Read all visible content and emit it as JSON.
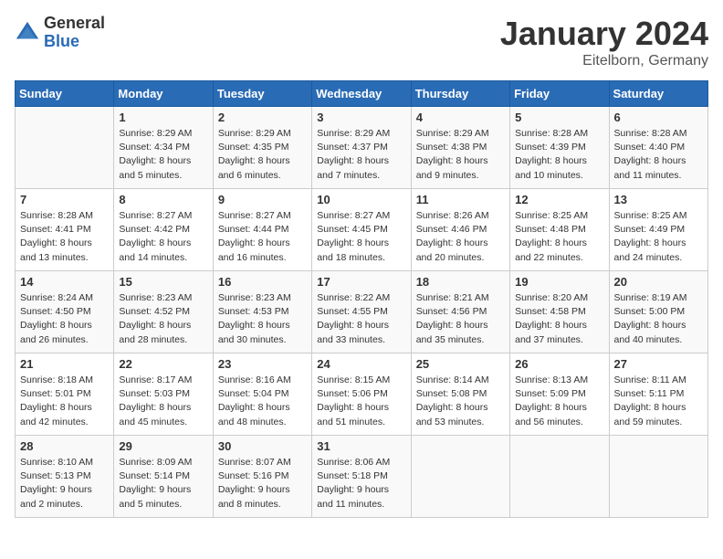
{
  "logo": {
    "text_general": "General",
    "text_blue": "Blue"
  },
  "title": "January 2024",
  "location": "Eitelborn, Germany",
  "weekdays": [
    "Sunday",
    "Monday",
    "Tuesday",
    "Wednesday",
    "Thursday",
    "Friday",
    "Saturday"
  ],
  "weeks": [
    [
      {
        "day": "",
        "sunrise": "",
        "sunset": "",
        "daylight": ""
      },
      {
        "day": "1",
        "sunrise": "Sunrise: 8:29 AM",
        "sunset": "Sunset: 4:34 PM",
        "daylight": "Daylight: 8 hours and 5 minutes."
      },
      {
        "day": "2",
        "sunrise": "Sunrise: 8:29 AM",
        "sunset": "Sunset: 4:35 PM",
        "daylight": "Daylight: 8 hours and 6 minutes."
      },
      {
        "day": "3",
        "sunrise": "Sunrise: 8:29 AM",
        "sunset": "Sunset: 4:37 PM",
        "daylight": "Daylight: 8 hours and 7 minutes."
      },
      {
        "day": "4",
        "sunrise": "Sunrise: 8:29 AM",
        "sunset": "Sunset: 4:38 PM",
        "daylight": "Daylight: 8 hours and 9 minutes."
      },
      {
        "day": "5",
        "sunrise": "Sunrise: 8:28 AM",
        "sunset": "Sunset: 4:39 PM",
        "daylight": "Daylight: 8 hours and 10 minutes."
      },
      {
        "day": "6",
        "sunrise": "Sunrise: 8:28 AM",
        "sunset": "Sunset: 4:40 PM",
        "daylight": "Daylight: 8 hours and 11 minutes."
      }
    ],
    [
      {
        "day": "7",
        "sunrise": "Sunrise: 8:28 AM",
        "sunset": "Sunset: 4:41 PM",
        "daylight": "Daylight: 8 hours and 13 minutes."
      },
      {
        "day": "8",
        "sunrise": "Sunrise: 8:27 AM",
        "sunset": "Sunset: 4:42 PM",
        "daylight": "Daylight: 8 hours and 14 minutes."
      },
      {
        "day": "9",
        "sunrise": "Sunrise: 8:27 AM",
        "sunset": "Sunset: 4:44 PM",
        "daylight": "Daylight: 8 hours and 16 minutes."
      },
      {
        "day": "10",
        "sunrise": "Sunrise: 8:27 AM",
        "sunset": "Sunset: 4:45 PM",
        "daylight": "Daylight: 8 hours and 18 minutes."
      },
      {
        "day": "11",
        "sunrise": "Sunrise: 8:26 AM",
        "sunset": "Sunset: 4:46 PM",
        "daylight": "Daylight: 8 hours and 20 minutes."
      },
      {
        "day": "12",
        "sunrise": "Sunrise: 8:25 AM",
        "sunset": "Sunset: 4:48 PM",
        "daylight": "Daylight: 8 hours and 22 minutes."
      },
      {
        "day": "13",
        "sunrise": "Sunrise: 8:25 AM",
        "sunset": "Sunset: 4:49 PM",
        "daylight": "Daylight: 8 hours and 24 minutes."
      }
    ],
    [
      {
        "day": "14",
        "sunrise": "Sunrise: 8:24 AM",
        "sunset": "Sunset: 4:50 PM",
        "daylight": "Daylight: 8 hours and 26 minutes."
      },
      {
        "day": "15",
        "sunrise": "Sunrise: 8:23 AM",
        "sunset": "Sunset: 4:52 PM",
        "daylight": "Daylight: 8 hours and 28 minutes."
      },
      {
        "day": "16",
        "sunrise": "Sunrise: 8:23 AM",
        "sunset": "Sunset: 4:53 PM",
        "daylight": "Daylight: 8 hours and 30 minutes."
      },
      {
        "day": "17",
        "sunrise": "Sunrise: 8:22 AM",
        "sunset": "Sunset: 4:55 PM",
        "daylight": "Daylight: 8 hours and 33 minutes."
      },
      {
        "day": "18",
        "sunrise": "Sunrise: 8:21 AM",
        "sunset": "Sunset: 4:56 PM",
        "daylight": "Daylight: 8 hours and 35 minutes."
      },
      {
        "day": "19",
        "sunrise": "Sunrise: 8:20 AM",
        "sunset": "Sunset: 4:58 PM",
        "daylight": "Daylight: 8 hours and 37 minutes."
      },
      {
        "day": "20",
        "sunrise": "Sunrise: 8:19 AM",
        "sunset": "Sunset: 5:00 PM",
        "daylight": "Daylight: 8 hours and 40 minutes."
      }
    ],
    [
      {
        "day": "21",
        "sunrise": "Sunrise: 8:18 AM",
        "sunset": "Sunset: 5:01 PM",
        "daylight": "Daylight: 8 hours and 42 minutes."
      },
      {
        "day": "22",
        "sunrise": "Sunrise: 8:17 AM",
        "sunset": "Sunset: 5:03 PM",
        "daylight": "Daylight: 8 hours and 45 minutes."
      },
      {
        "day": "23",
        "sunrise": "Sunrise: 8:16 AM",
        "sunset": "Sunset: 5:04 PM",
        "daylight": "Daylight: 8 hours and 48 minutes."
      },
      {
        "day": "24",
        "sunrise": "Sunrise: 8:15 AM",
        "sunset": "Sunset: 5:06 PM",
        "daylight": "Daylight: 8 hours and 51 minutes."
      },
      {
        "day": "25",
        "sunrise": "Sunrise: 8:14 AM",
        "sunset": "Sunset: 5:08 PM",
        "daylight": "Daylight: 8 hours and 53 minutes."
      },
      {
        "day": "26",
        "sunrise": "Sunrise: 8:13 AM",
        "sunset": "Sunset: 5:09 PM",
        "daylight": "Daylight: 8 hours and 56 minutes."
      },
      {
        "day": "27",
        "sunrise": "Sunrise: 8:11 AM",
        "sunset": "Sunset: 5:11 PM",
        "daylight": "Daylight: 8 hours and 59 minutes."
      }
    ],
    [
      {
        "day": "28",
        "sunrise": "Sunrise: 8:10 AM",
        "sunset": "Sunset: 5:13 PM",
        "daylight": "Daylight: 9 hours and 2 minutes."
      },
      {
        "day": "29",
        "sunrise": "Sunrise: 8:09 AM",
        "sunset": "Sunset: 5:14 PM",
        "daylight": "Daylight: 9 hours and 5 minutes."
      },
      {
        "day": "30",
        "sunrise": "Sunrise: 8:07 AM",
        "sunset": "Sunset: 5:16 PM",
        "daylight": "Daylight: 9 hours and 8 minutes."
      },
      {
        "day": "31",
        "sunrise": "Sunrise: 8:06 AM",
        "sunset": "Sunset: 5:18 PM",
        "daylight": "Daylight: 9 hours and 11 minutes."
      },
      {
        "day": "",
        "sunrise": "",
        "sunset": "",
        "daylight": ""
      },
      {
        "day": "",
        "sunrise": "",
        "sunset": "",
        "daylight": ""
      },
      {
        "day": "",
        "sunrise": "",
        "sunset": "",
        "daylight": ""
      }
    ]
  ]
}
